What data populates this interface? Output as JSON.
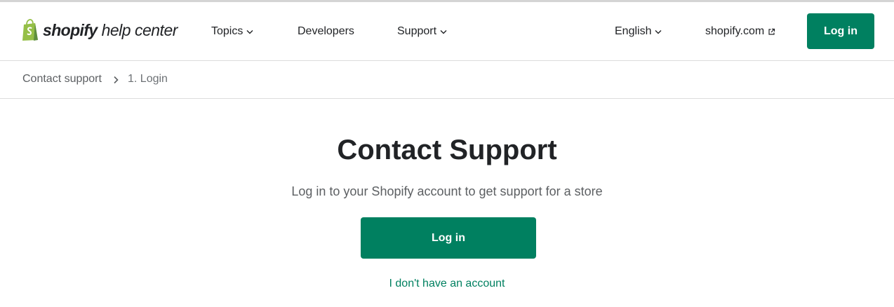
{
  "header": {
    "logo": {
      "brand": "shopify",
      "subtitle": "help center",
      "icon": "shopify-bag-icon",
      "icon_color": "#95bf47"
    },
    "nav": {
      "topics": "Topics",
      "developers": "Developers",
      "support": "Support"
    },
    "language": "English",
    "external_link": "shopify.com",
    "login_label": "Log in"
  },
  "breadcrumb": {
    "parent": "Contact support",
    "current": "1. Login"
  },
  "main": {
    "title": "Contact Support",
    "subtitle": "Log in to your Shopify account to get support for a store",
    "login_label": "Log in",
    "no_account_link": "I don't have an account"
  },
  "colors": {
    "accent": "#008060",
    "text": "#212326",
    "muted": "#5c5f62",
    "divider": "#dcdcdc"
  }
}
